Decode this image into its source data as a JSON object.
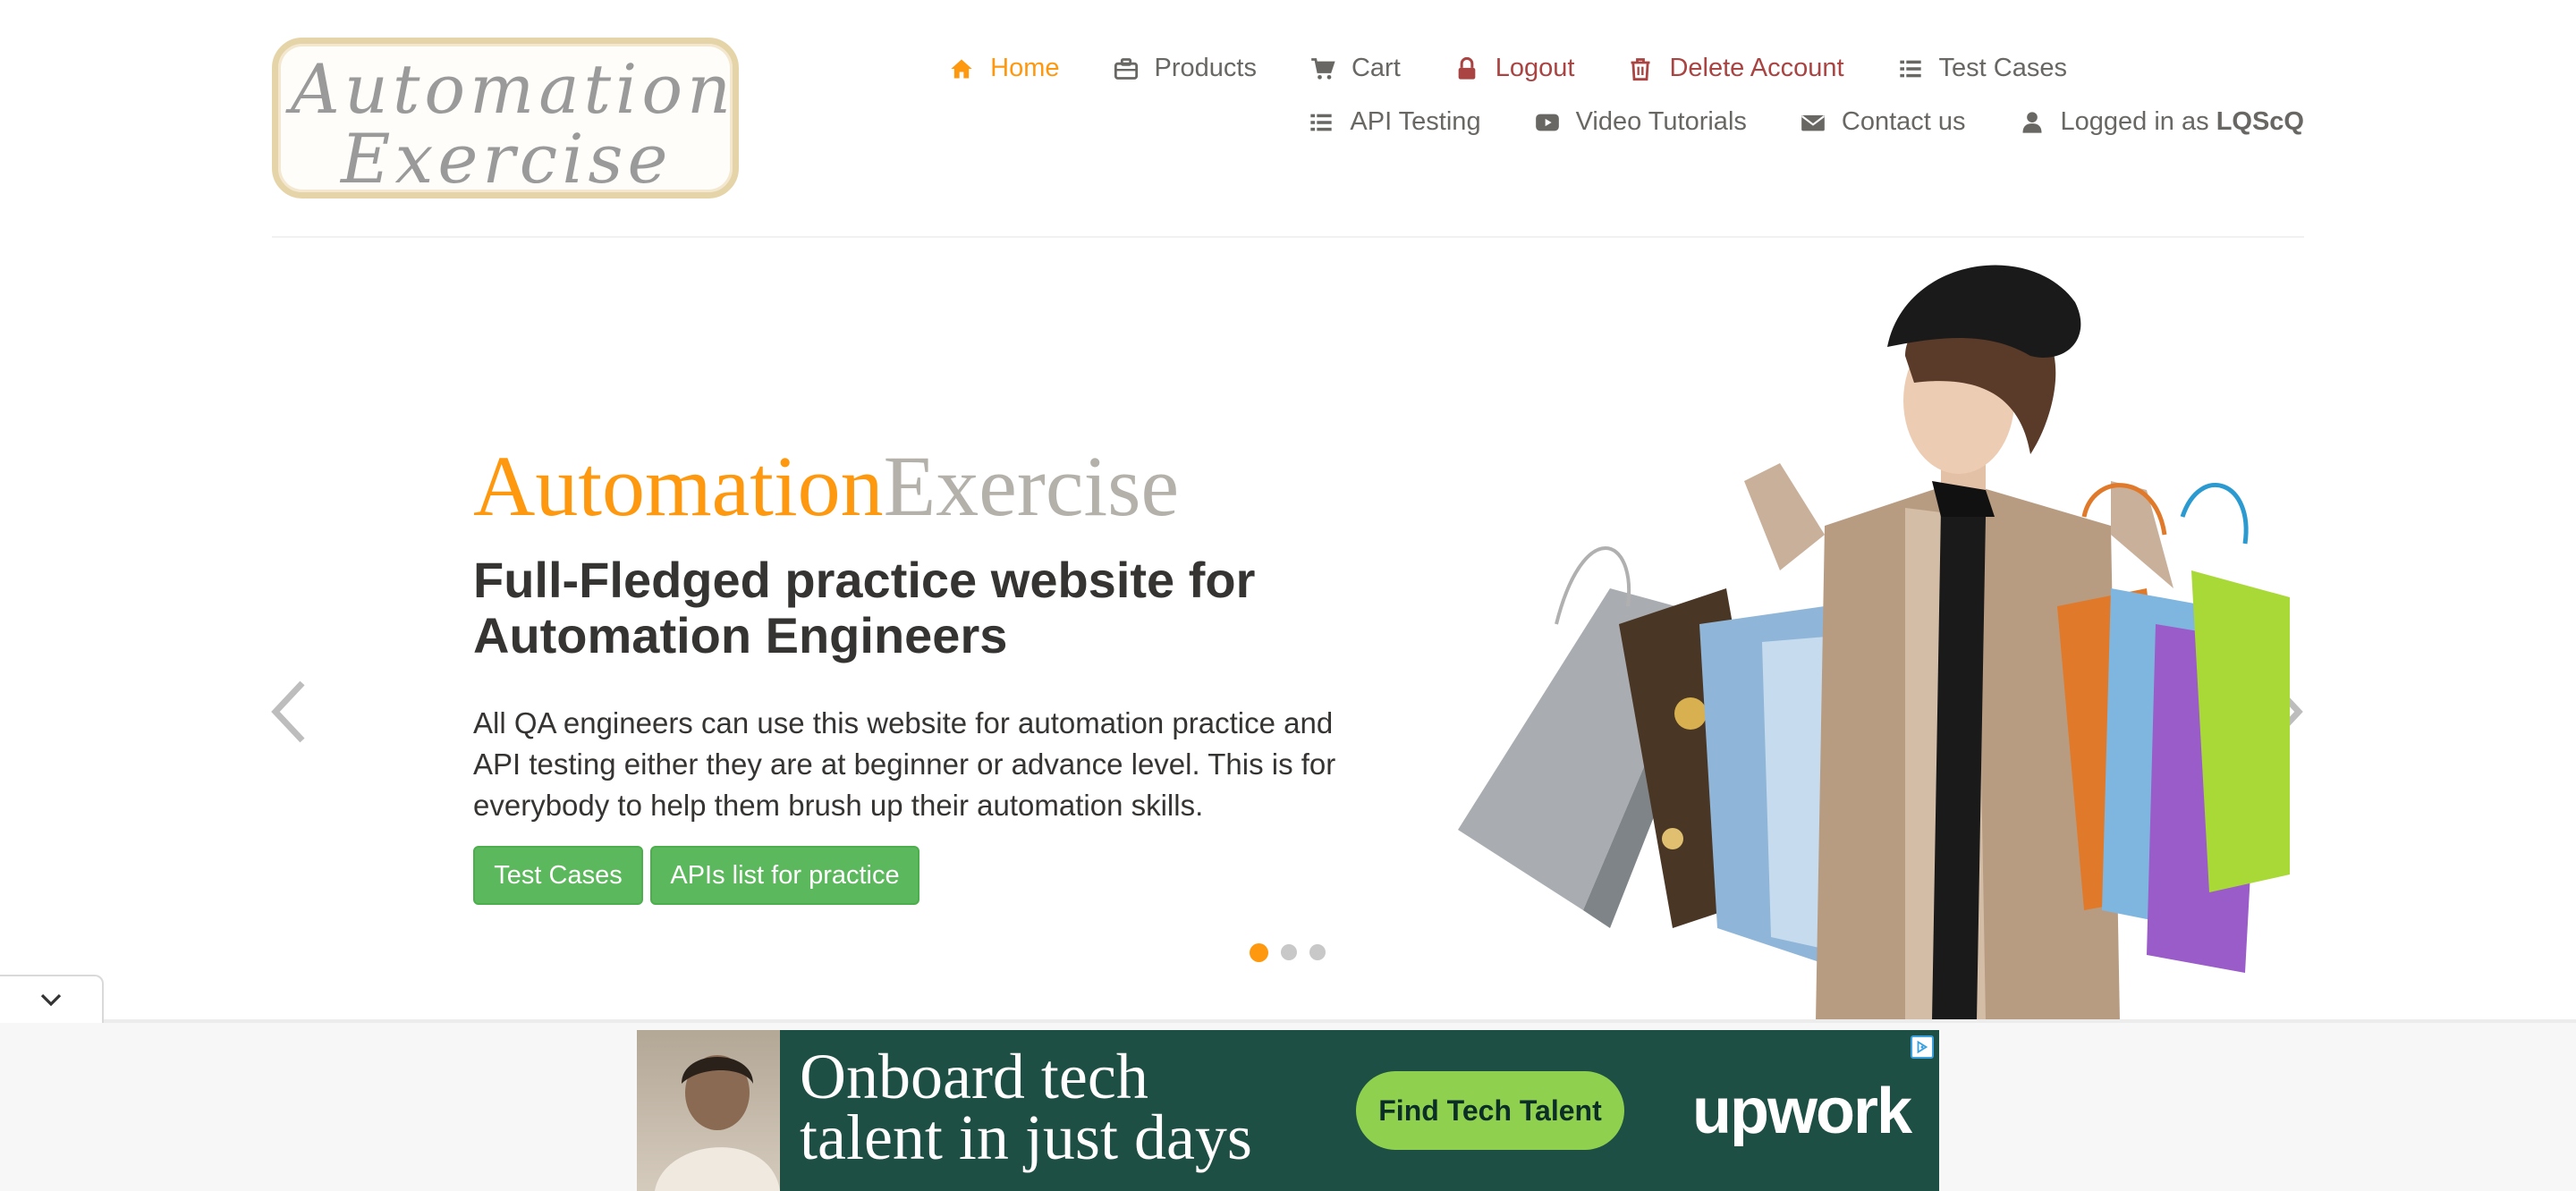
{
  "logo": {
    "line1": "Automation",
    "line2": "Exercise"
  },
  "nav": {
    "row1": [
      {
        "label": "Home",
        "icon": "home-icon"
      },
      {
        "label": "Products",
        "icon": "briefcase-icon"
      },
      {
        "label": "Cart",
        "icon": "cart-icon"
      },
      {
        "label": "Logout",
        "icon": "lock-icon"
      },
      {
        "label": "Delete Account",
        "icon": "trash-icon"
      },
      {
        "label": "Test Cases",
        "icon": "list-icon"
      }
    ],
    "row2": [
      {
        "label": "API Testing",
        "icon": "list-icon"
      },
      {
        "label": "Video Tutorials",
        "icon": "youtube-play-icon"
      },
      {
        "label": "Contact us",
        "icon": "envelope-icon"
      },
      {
        "label": "Logged in as",
        "icon": "user-icon"
      }
    ],
    "username": "LQScQ"
  },
  "slider": {
    "title_part1": "Automation",
    "title_part2": "Exercise",
    "heading": "Full-Fledged practice website for Automation Engineers",
    "text": "All QA engineers can use this website for automation practice and API testing either they are at beginner or advance level. This is for everybody to help them brush up their automation skills.",
    "btn_test_cases": "Test Cases",
    "btn_apis": "APIs list for practice",
    "active_slide": 1,
    "slide_count": 3
  },
  "ad": {
    "headline_line1": "Onboard tech",
    "headline_line2": "talent in just days",
    "cta": "Find Tech Talent",
    "brand": "upwork"
  },
  "colors": {
    "accent": "#fe980f",
    "text": "#696763",
    "danger": "#a94442",
    "button_green": "#5cb85c",
    "ad_background": "#1d4f44",
    "ad_cta": "#8fd14f"
  }
}
